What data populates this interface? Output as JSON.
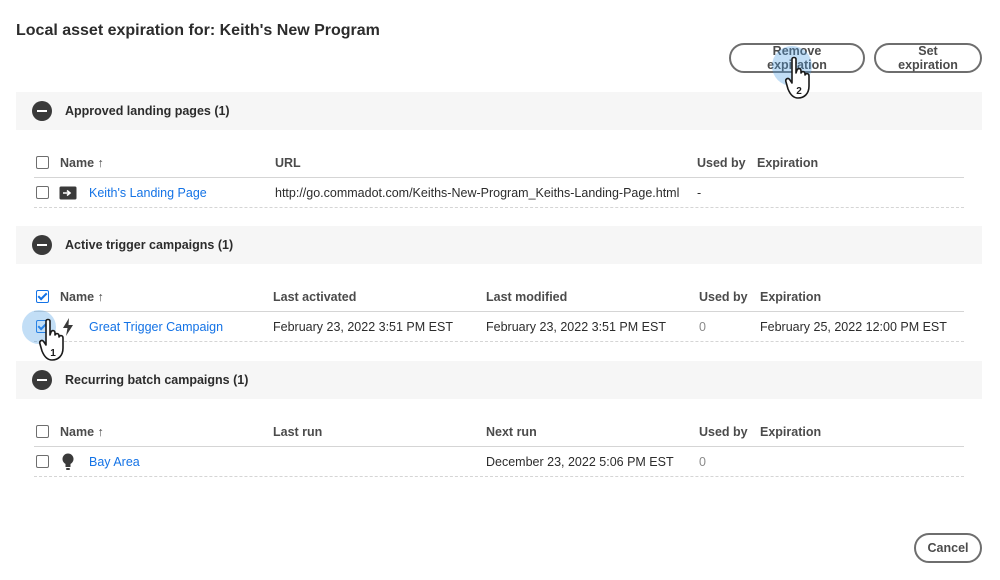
{
  "dialog": {
    "title": "Local asset expiration for: Keith's New Program",
    "remove_label": "Remove expiration",
    "set_label": "Set expiration",
    "cancel_label": "Cancel"
  },
  "sections": {
    "landing": {
      "title": "Approved landing pages (1)",
      "headers": {
        "name": "Name ↑",
        "url": "URL",
        "used_by": "Used by",
        "expiration": "Expiration"
      },
      "row": {
        "name": "Keith's Landing Page",
        "url": "http://go.commadot.com/Keiths-New-Program_Keiths-Landing-Page.html",
        "used_by": "-",
        "expiration": ""
      }
    },
    "trigger": {
      "title": "Active trigger campaigns (1)",
      "headers": {
        "name": "Name ↑",
        "last_activated": "Last activated",
        "last_modified": "Last modified",
        "used_by": "Used by",
        "expiration": "Expiration"
      },
      "row": {
        "name": "Great Trigger Campaign",
        "last_activated": "February 23, 2022 3:51 PM EST",
        "last_modified": "February 23, 2022 3:51 PM EST",
        "used_by": "0",
        "expiration": "February 25, 2022 12:00 PM EST"
      }
    },
    "batch": {
      "title": "Recurring batch campaigns (1)",
      "headers": {
        "name": "Name ↑",
        "last_run": "Last run",
        "next_run": "Next run",
        "used_by": "Used by",
        "expiration": "Expiration"
      },
      "row": {
        "name": "Bay Area",
        "last_run": "",
        "next_run": "December 23, 2022 5:06 PM EST",
        "used_by": "0",
        "expiration": ""
      }
    }
  },
  "annotations": {
    "step1": "1",
    "step2": "2"
  },
  "icons": {
    "landing": "landing-page-icon",
    "trigger": "lightning-bolt-icon",
    "batch": "lightbulb-icon",
    "collapse": "minus-circle-icon",
    "cursor": "hand-pointer-icon"
  },
  "colors": {
    "link": "#1473e6",
    "text": "#2c2c2c",
    "section_bg": "#f6f6f6",
    "highlight": "#50a0e6"
  }
}
